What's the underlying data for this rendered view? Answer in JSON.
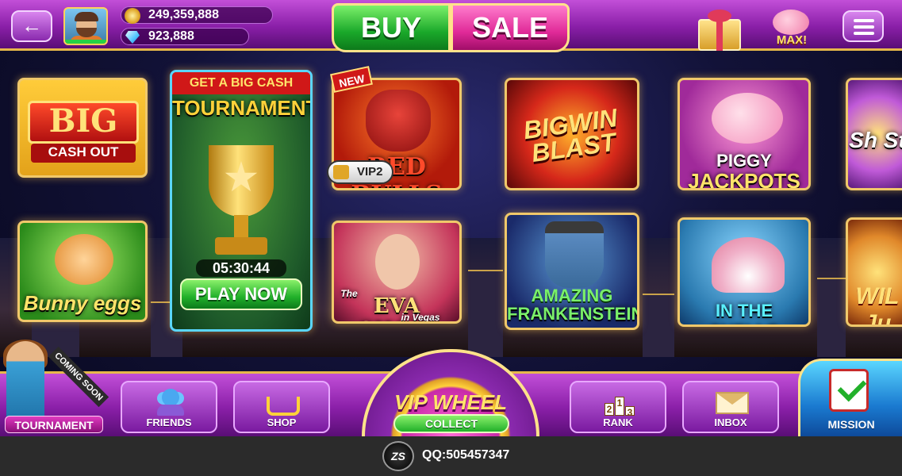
{
  "header": {
    "back_icon": "back-arrow-icon",
    "coins": "249,359,888",
    "gems": "923,888",
    "buy_label": "BUY",
    "sale_label": "SALE",
    "piggy_label": "MAX!"
  },
  "games": {
    "big_cash_out": {
      "title1": "BIG",
      "title2": "CASH OUT"
    },
    "tournament": {
      "banner": "GET A BIG CASH",
      "title": "TOURNAMENT",
      "timer": "05:30:44",
      "play_label": "PLAY NOW"
    },
    "red_bulls": {
      "title": "RED BULLS",
      "new_tag": "NEW",
      "vip": "VIP2"
    },
    "bigwin_blast": {
      "title": "BIGWIN BLAST"
    },
    "piggy_jackpots": {
      "title1": "PIGGY",
      "title2": "JACKPOTS"
    },
    "shining": {
      "title": "Sh St"
    },
    "bunny_eggs": {
      "title": "Bunny eggs"
    },
    "eva_show": {
      "title": "EVA SHOW",
      "sub": "The",
      "sub2": "in Vegas"
    },
    "frankenstein": {
      "title1": "AMAZING",
      "title2": "FRANKENSTEIN"
    },
    "in_the_shells": {
      "title": "IN THE SHELLS"
    },
    "wild": {
      "title": "WIL Ju"
    }
  },
  "bottom_nav": {
    "promo_label": "TOURNAMENT",
    "coming_soon": "COMING SOON",
    "friends": "FRIENDS",
    "shop": "SHOP",
    "vip_wheel": "VIP WHEEL",
    "collect": "COLLECT",
    "rank": "RANK",
    "rank_digits": [
      "2",
      "1",
      "3"
    ],
    "inbox": "INBOX",
    "mission": "MISSION"
  },
  "footer": {
    "logo": "ZS",
    "qq": "QQ:505457347"
  }
}
